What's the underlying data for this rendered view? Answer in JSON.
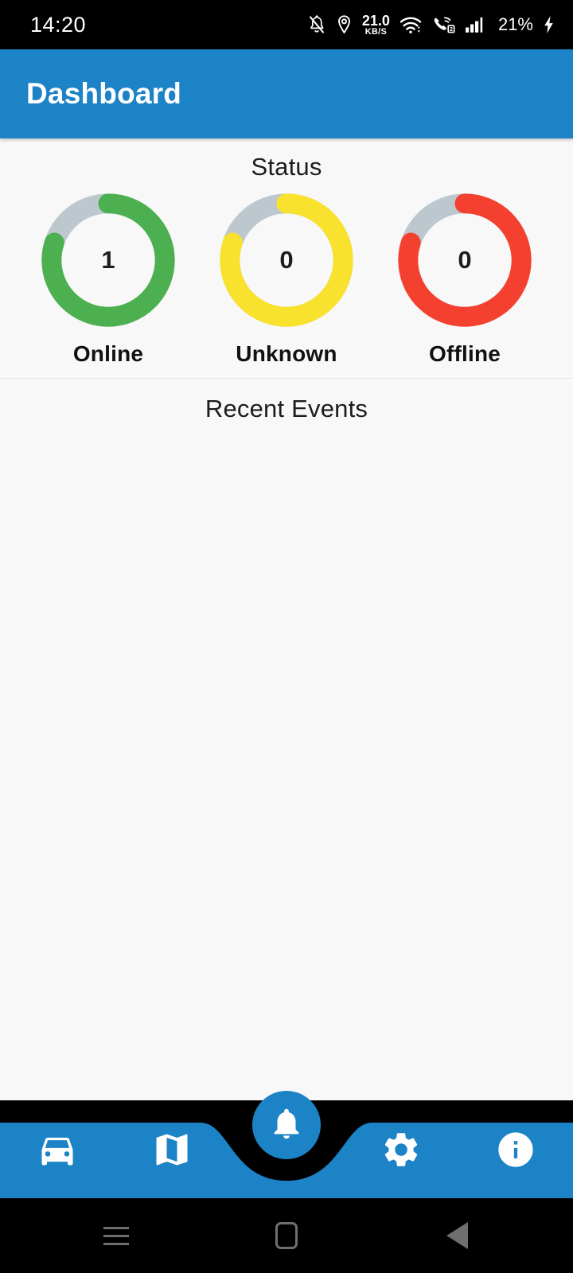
{
  "status_bar": {
    "time": "14:20",
    "network_speed_value": "21.0",
    "network_speed_unit": "KB/S",
    "battery_percent": "21%",
    "icons": [
      "notifications-off-icon",
      "location-pin-icon",
      "network-speed-icon",
      "wifi-icon",
      "call-signal-icon",
      "cellular-signal-icon",
      "battery-charging-icon"
    ],
    "sim_badge": "2",
    "background_color": "#000000",
    "foreground_color": "#ffffff"
  },
  "app_bar": {
    "title": "Dashboard",
    "background_color": "#1b83c6",
    "title_color": "#ffffff"
  },
  "status_section": {
    "title": "Status",
    "gauges": [
      {
        "label": "Online",
        "value": "1",
        "color": "#4caf50",
        "track_color": "#bcc8cd",
        "percent": 80
      },
      {
        "label": "Unknown",
        "value": "0",
        "color": "#f9e22e",
        "track_color": "#bcc8cd",
        "percent": 80
      },
      {
        "label": "Offline",
        "value": "0",
        "color": "#f4402f",
        "track_color": "#bcc8cd",
        "percent": 80
      }
    ]
  },
  "events_section": {
    "title": "Recent Events",
    "items": []
  },
  "bottom_nav": {
    "background_color": "#1b83c6",
    "items": [
      {
        "name": "vehicles",
        "icon": "car-icon"
      },
      {
        "name": "map",
        "icon": "map-icon"
      },
      {
        "name": "settings",
        "icon": "gear-icon"
      },
      {
        "name": "info",
        "icon": "info-icon"
      }
    ],
    "fab": {
      "name": "alerts",
      "icon": "bell-icon",
      "color": "#1b83c6"
    }
  },
  "system_nav": {
    "buttons": [
      "recents-icon",
      "home-icon",
      "back-icon"
    ],
    "background_color": "#000000"
  },
  "chart_data": {
    "type": "pie",
    "title": "Status",
    "categories": [
      "Online",
      "Unknown",
      "Offline"
    ],
    "values": [
      1,
      0,
      0
    ],
    "series": [
      {
        "name": "Online",
        "value": 1,
        "arc_percent": 80,
        "color": "#4caf50"
      },
      {
        "name": "Unknown",
        "value": 0,
        "arc_percent": 80,
        "color": "#f9e22e"
      },
      {
        "name": "Offline",
        "value": 0,
        "arc_percent": 80,
        "color": "#f4402f"
      }
    ],
    "track_color": "#bcc8cd",
    "legend": "below-each-ring",
    "grid": false
  }
}
